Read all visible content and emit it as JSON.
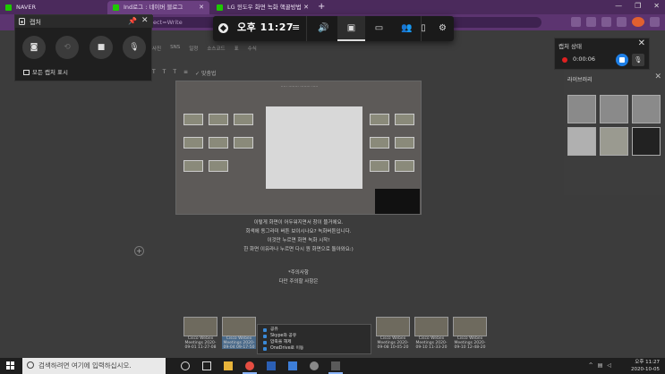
{
  "browser": {
    "tabs": [
      {
        "label": "NAVER"
      },
      {
        "label": "Ind로그 : 네이버 블로그"
      },
      {
        "label": "LG 윈도우 화면 녹화 핵꿀방법"
      }
    ],
    "address": "ect=Write"
  },
  "editor": {
    "toolbar": [
      "사진",
      "SNS",
      "",
      "일정",
      "소스코드",
      "표",
      "수식"
    ],
    "format": [
      "T",
      "T",
      "T",
      "≡",
      "✓ 맞춤법"
    ],
    "paragraph_lines": [
      "이렇게 화면이 어두워지면서 창이 뜰거에요.",
      "회색에 동그라미 버튼 보이시나요? 녹화버튼입니다.",
      "이것만 누르면 화면 녹화 시작!",
      "한 화면 이유라나 누르면 다시 원 화면으로 돌아와요:)"
    ],
    "caution_title": "*주의사항",
    "caution_sub": "다만 주의할 사항은",
    "cards": [
      {
        "label": "Cisco Webex Meetings 2020-09-01 11-27-08"
      },
      {
        "label": "Cisco Webex Meetings 2020-09-04 09-17-50"
      },
      {
        "label": ""
      },
      {
        "label": ""
      },
      {
        "label": ""
      },
      {
        "label": "Cisco Webex Meetings 2020-09-08 10-05-20"
      },
      {
        "label": "Cisco Webex Meetings 2020-09-10 11-33-20"
      },
      {
        "label": "Cisco Webex Meetings 2020-09-10 12-48-20"
      }
    ],
    "context_menu": [
      "공유",
      "Skype와 공유",
      "압축을 해제",
      "OneDrive로 이동"
    ]
  },
  "library": {
    "title": "라이브러리"
  },
  "gamebar": {
    "time": "오후 11:27",
    "buttons": [
      "volume",
      "capture",
      "performance",
      "xbox-social",
      "settings-mouse",
      "settings"
    ]
  },
  "capture": {
    "title": "캡처",
    "show_all": "모든 캡처 표시"
  },
  "capture_status": {
    "title": "캡처 상태",
    "timer": "0:00:06"
  },
  "taskbar": {
    "search_placeholder": "검색하려면 여기에 입력하십시오.",
    "time": "오후 11:27",
    "date": "2020-10-05"
  },
  "colors": {
    "record_red": "#e02020",
    "stop_blue": "#1e7fe6",
    "tabbar": "#4b2a5c"
  }
}
